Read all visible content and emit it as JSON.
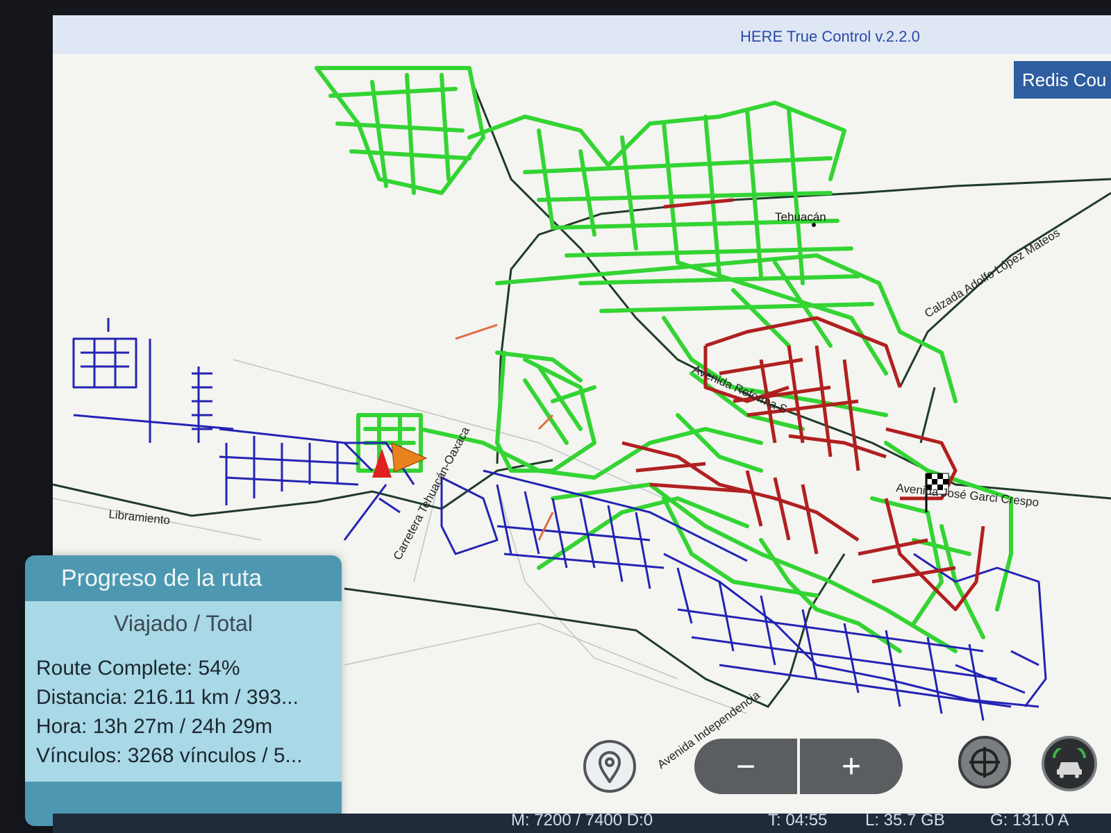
{
  "app": {
    "title": "HERE True Control v.2.2.0",
    "redis_button": "Redis Cou"
  },
  "map": {
    "labels": {
      "city": "Tehuacán",
      "calzada": "Calzada Adolfo López Mateos",
      "reforma": "Avenida Reforma S",
      "garci": "Avenida José Garci Crespo",
      "carretera": "Carretera Tehuacán-Oaxaca",
      "libramiento": "Libramiento",
      "independencia": "Avenida Independencia"
    },
    "colors": {
      "traveled": "#33d433",
      "remaining": "#2323b4",
      "problem": "#b02020",
      "road": "#1f3a2a",
      "minor": "#bdbdbd"
    }
  },
  "progress_panel": {
    "title": "Progreso de la ruta",
    "subtitle": "Viajado / Total",
    "route_complete": "Route Complete: 54%",
    "distance": "Distancia: 216.11 km / 393...",
    "time": "Hora: 13h 27m / 24h 29m",
    "links": "Vínculos: 3268 vínculos / 5..."
  },
  "controls": {
    "location_icon": "map-pin-icon",
    "zoom_out": "−",
    "zoom_in": "+",
    "recenter_icon": "crosshair-icon",
    "car_icon": "car-follow-icon"
  },
  "status_bar": {
    "left": "M: 7200 / 7400 D:0",
    "time": "T: 04:55",
    "l_value": "L: 35.7 GB",
    "g_value": "G: 131.0 A"
  }
}
